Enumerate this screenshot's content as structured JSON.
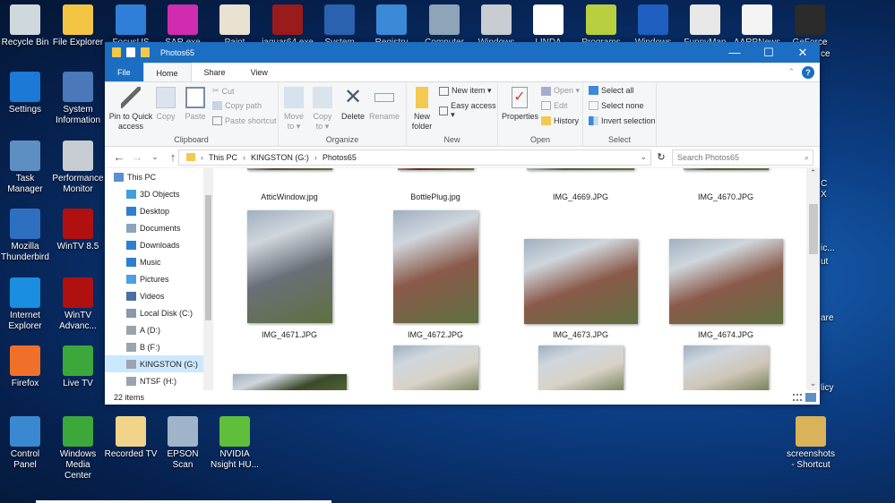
{
  "desktop": {
    "top_row": [
      {
        "label": "Recycle Bin",
        "color": "#cfd8dc"
      },
      {
        "label": "File Explorer",
        "color": "#f4c542"
      },
      {
        "label": "FocusUS",
        "color": "#2f7fd8"
      },
      {
        "label": "SAR.exe",
        "color": "#d02cb0"
      },
      {
        "label": "Paint",
        "color": "#e9e2d0"
      },
      {
        "label": "jaguar64.exe",
        "color": "#9a1b1b"
      },
      {
        "label": "System",
        "color": "#2a62b0"
      },
      {
        "label": "Registry",
        "color": "#3a8ad8"
      },
      {
        "label": "Computer",
        "color": "#8fa4b8"
      },
      {
        "label": "Windows",
        "color": "#c9ccd0"
      },
      {
        "label": "LINDA SCOTT",
        "color": "#ffffff"
      },
      {
        "label": "Programs",
        "color": "#b8d040"
      },
      {
        "label": "Windows",
        "color": "#1f5fbf"
      },
      {
        "label": "FunnyMan",
        "color": "#e8e8e8"
      },
      {
        "label": "AARPNews",
        "color": "#f4f4f4"
      },
      {
        "label": "GeForce",
        "color": "#2b2b2b"
      }
    ],
    "left_col1": [
      {
        "label": "Settings",
        "color": "#1d79d6"
      },
      {
        "label": "Task Manager",
        "color": "#5e8fc2"
      },
      {
        "label": "Mozilla Thunderbird",
        "color": "#2f6fc0"
      },
      {
        "label": "Internet Explorer",
        "color": "#1b8ee0"
      },
      {
        "label": "Firefox",
        "color": "#f0702a"
      }
    ],
    "left_col2": [
      {
        "label": "System Information",
        "color": "#4a78b8"
      },
      {
        "label": "Performance Monitor",
        "color": "#c8cdd3"
      },
      {
        "label": "WinTV 8.5",
        "color": "#b01010"
      },
      {
        "label": "WinTV Advanc...",
        "color": "#b01010"
      },
      {
        "label": "Live TV",
        "color": "#3ca83c"
      }
    ],
    "bottom_row": [
      {
        "label": "Control Panel",
        "color": "#3a88d0"
      },
      {
        "label": "Windows Media Center",
        "color": "#3ca83c"
      },
      {
        "label": "Recorded TV",
        "color": "#f1d48a"
      },
      {
        "label": "EPSON Scan",
        "color": "#9fb4c8"
      },
      {
        "label": "NVIDIA Nsight HU...",
        "color": "#5fbf3a"
      }
    ],
    "screenshots": {
      "label": "screenshots - Shortcut",
      "color": "#d9b25a"
    },
    "right_fragments": [
      "ce",
      "C",
      "X",
      "ic...",
      "ut",
      "are",
      "licy"
    ]
  },
  "window": {
    "title": "Photos65",
    "controls": {
      "minimize": "—",
      "maximize": "☐",
      "close": "✕"
    },
    "tabs": [
      "File",
      "Home",
      "Share",
      "View"
    ],
    "help": "?",
    "ribbon": {
      "clipboard": {
        "label": "Clipboard",
        "pin": "Pin to Quick access",
        "copy": "Copy",
        "paste": "Paste",
        "cut": "Cut",
        "copy_path": "Copy path",
        "paste_shortcut": "Paste shortcut"
      },
      "organize": {
        "label": "Organize",
        "move_to": "Move to ▾",
        "copy_to": "Copy to ▾",
        "delete": "Delete",
        "rename": "Rename"
      },
      "new": {
        "label": "New",
        "new_folder": "New folder",
        "new_item": "New item ▾",
        "easy_access": "Easy access ▾"
      },
      "open": {
        "label": "Open",
        "properties": "Properties",
        "open": "Open ▾",
        "edit": "Edit",
        "history": "History"
      },
      "select": {
        "label": "Select",
        "select_all": "Select all",
        "select_none": "Select none",
        "invert": "Invert selection"
      }
    },
    "address": {
      "back": "←",
      "forward": "→",
      "recent": "⌄",
      "up": "↑",
      "path": [
        "This PC",
        "KINGSTON (G:)",
        "Photos65"
      ],
      "refresh": "↻",
      "search_placeholder": "Search Photos65"
    },
    "nav_pane": [
      {
        "label": "This PC",
        "color": "#5a8fd0"
      },
      {
        "label": "3D Objects",
        "color": "#3fa0e0"
      },
      {
        "label": "Desktop",
        "color": "#2f7fd0"
      },
      {
        "label": "Documents",
        "color": "#8aa4c0"
      },
      {
        "label": "Downloads",
        "color": "#2f7fd0"
      },
      {
        "label": "Music",
        "color": "#2f7fd0"
      },
      {
        "label": "Pictures",
        "color": "#4aa0e0"
      },
      {
        "label": "Videos",
        "color": "#4a6fa0"
      },
      {
        "label": "Local Disk (C:)",
        "color": "#8a98a8"
      },
      {
        "label": "A (D:)",
        "color": "#9aa4ae"
      },
      {
        "label": "B (F:)",
        "color": "#9aa4ae"
      },
      {
        "label": "KINGSTON (G:)",
        "color": "#9aa4ae",
        "selected": true
      },
      {
        "label": "NTSF (H:)",
        "color": "#9aa4ae"
      }
    ],
    "files": [
      {
        "name": "AtticWindow.jpg",
        "tone": "#5a4a3a"
      },
      {
        "name": "BottlePlug.jpg",
        "tone": "#6b2a1e"
      },
      {
        "name": "IMG_4669.JPG",
        "tone": "#4e5a3a"
      },
      {
        "name": "IMG_4670.JPG",
        "tone": "#4e5a3a"
      },
      {
        "name": "IMG_4671.JPG",
        "tone": "#6a7078"
      },
      {
        "name": "IMG_4672.JPG",
        "tone": "#8a5a4a"
      },
      {
        "name": "IMG_4673.JPG",
        "tone": "#8a5a4a"
      },
      {
        "name": "IMG_4674.JPG",
        "tone": "#8a5a4a"
      },
      {
        "name": "",
        "tone": "#3a4a2a"
      },
      {
        "name": "",
        "tone": "#d8d2c8"
      },
      {
        "name": "",
        "tone": "#d8d2c8"
      },
      {
        "name": "",
        "tone": "#cfc6b8"
      }
    ],
    "status": "22 items"
  }
}
